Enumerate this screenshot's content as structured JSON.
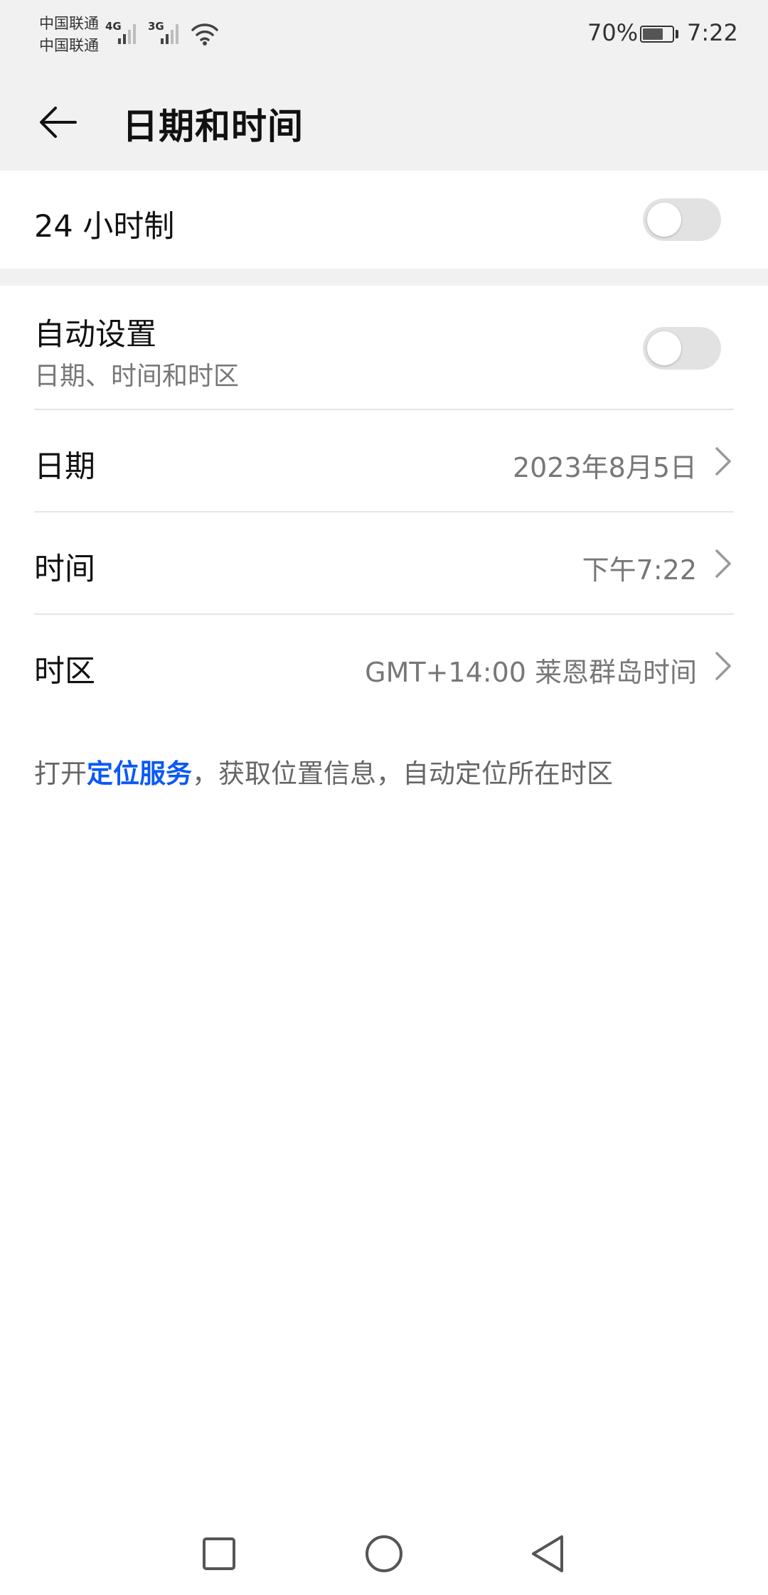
{
  "status_bar": {
    "carrier1": "中国联通",
    "carrier2": "中国联通",
    "network1": "4G",
    "network2": "3G",
    "battery_percent": "70%",
    "battery_level": 0.7,
    "time": "7:22",
    "icons": [
      "signal-icon",
      "wifi-icon",
      "battery-icon"
    ]
  },
  "header": {
    "back_icon": "arrow-left-icon",
    "title": "日期和时间"
  },
  "settings": {
    "hour24": {
      "label": "24 小时制",
      "enabled": false
    },
    "auto": {
      "label": "自动设置",
      "sublabel": "日期、时间和时区",
      "enabled": false
    },
    "date": {
      "label": "日期",
      "value": "2023年8月5日"
    },
    "time": {
      "label": "时间",
      "value": "下午7:22"
    },
    "timezone": {
      "label": "时区",
      "value": "GMT+14:00 莱恩群岛时间"
    }
  },
  "hint": {
    "prefix": "打开",
    "link": "定位服务",
    "suffix": "，获取位置信息，自动定位所在时区"
  },
  "colors": {
    "background": "#ffffff",
    "header_bg": "#f1f1f1",
    "link": "#0a59f7",
    "secondary_text": "#777777"
  },
  "navigation": {
    "recent_icon": "square-icon",
    "home_icon": "circle-icon",
    "back_icon": "triangle-back-icon"
  }
}
